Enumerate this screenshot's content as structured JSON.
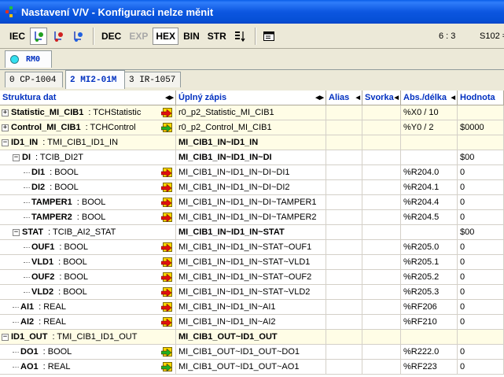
{
  "window": {
    "title": "Nastavení V/V - Konfiguraci nelze měnit"
  },
  "toolbar": {
    "iec": "IEC",
    "dec": "DEC",
    "exp": "EXP",
    "hex": "HEX",
    "bin": "BIN",
    "str": "STR",
    "position": "6 : 3",
    "status": "S102 ="
  },
  "rack": {
    "label": "RM0"
  },
  "module_tabs": [
    "0 CP-1004",
    "2 MI2-01M",
    "3 IR-1057"
  ],
  "columns": [
    "Struktura dat",
    "Úplný zápis",
    "Alias",
    "Svorka",
    "Abs./délka",
    "Hodnota"
  ],
  "rows": [
    {
      "name": "Statistic_MI_CIB1",
      "type": ": TCHStatistic",
      "full": "r0_p2_Statistic_MI_CIB1",
      "alias": "",
      "term": "",
      "abs": "%X0 / 10",
      "value": ""
    },
    {
      "name": "Control_MI_CIB1",
      "type": ": TCHControl",
      "full": "r0_p2_Control_MI_CIB1",
      "alias": "",
      "term": "",
      "abs": "%Y0 / 2",
      "value": "$0000"
    },
    {
      "name": "ID1_IN",
      "type": ": TMI_CIB1_ID1_IN",
      "full": "MI_CIB1_IN~ID1_IN",
      "alias": "",
      "term": "",
      "abs": "",
      "value": ""
    },
    {
      "name": "DI",
      "type": ": TCIB_DI2T",
      "full": "MI_CIB1_IN~ID1_IN~DI",
      "alias": "",
      "term": "",
      "abs": "",
      "value": "$00"
    },
    {
      "name": "DI1",
      "type": ": BOOL",
      "full": "MI_CIB1_IN~ID1_IN~DI~DI1",
      "alias": "",
      "term": "",
      "abs": "%R204.0",
      "value": "0"
    },
    {
      "name": "DI2",
      "type": ": BOOL",
      "full": "MI_CIB1_IN~ID1_IN~DI~DI2",
      "alias": "",
      "term": "",
      "abs": "%R204.1",
      "value": "0"
    },
    {
      "name": "TAMPER1",
      "type": ": BOOL",
      "full": "MI_CIB1_IN~ID1_IN~DI~TAMPER1",
      "alias": "",
      "term": "",
      "abs": "%R204.4",
      "value": "0"
    },
    {
      "name": "TAMPER2",
      "type": ": BOOL",
      "full": "MI_CIB1_IN~ID1_IN~DI~TAMPER2",
      "alias": "",
      "term": "",
      "abs": "%R204.5",
      "value": "0"
    },
    {
      "name": "STAT",
      "type": ": TCIB_AI2_STAT",
      "full": "MI_CIB1_IN~ID1_IN~STAT",
      "alias": "",
      "term": "",
      "abs": "",
      "value": "$00"
    },
    {
      "name": "OUF1",
      "type": ": BOOL",
      "full": "MI_CIB1_IN~ID1_IN~STAT~OUF1",
      "alias": "",
      "term": "",
      "abs": "%R205.0",
      "value": "0"
    },
    {
      "name": "VLD1",
      "type": ": BOOL",
      "full": "MI_CIB1_IN~ID1_IN~STAT~VLD1",
      "alias": "",
      "term": "",
      "abs": "%R205.1",
      "value": "0"
    },
    {
      "name": "OUF2",
      "type": ": BOOL",
      "full": "MI_CIB1_IN~ID1_IN~STAT~OUF2",
      "alias": "",
      "term": "",
      "abs": "%R205.2",
      "value": "0"
    },
    {
      "name": "VLD2",
      "type": ": BOOL",
      "full": "MI_CIB1_IN~ID1_IN~STAT~VLD2",
      "alias": "",
      "term": "",
      "abs": "%R205.3",
      "value": "0"
    },
    {
      "name": "AI1",
      "type": ": REAL",
      "full": "MI_CIB1_IN~ID1_IN~AI1",
      "alias": "",
      "term": "",
      "abs": "%RF206",
      "value": "0"
    },
    {
      "name": "AI2",
      "type": ": REAL",
      "full": "MI_CIB1_IN~ID1_IN~AI2",
      "alias": "",
      "term": "",
      "abs": "%RF210",
      "value": "0"
    },
    {
      "name": "ID1_OUT",
      "type": ": TMI_CIB1_ID1_OUT",
      "full": "MI_CIB1_OUT~ID1_OUT",
      "alias": "",
      "term": "",
      "abs": "",
      "value": ""
    },
    {
      "name": "DO1",
      "type": ": BOOL",
      "full": "MI_CIB1_OUT~ID1_OUT~DO1",
      "alias": "",
      "term": "",
      "abs": "%R222.0",
      "value": "0"
    },
    {
      "name": "AO1",
      "type": ": REAL",
      "full": "MI_CIB1_OUT~ID1_OUT~AO1",
      "alias": "",
      "term": "",
      "abs": "%RF223",
      "value": "0"
    }
  ]
}
